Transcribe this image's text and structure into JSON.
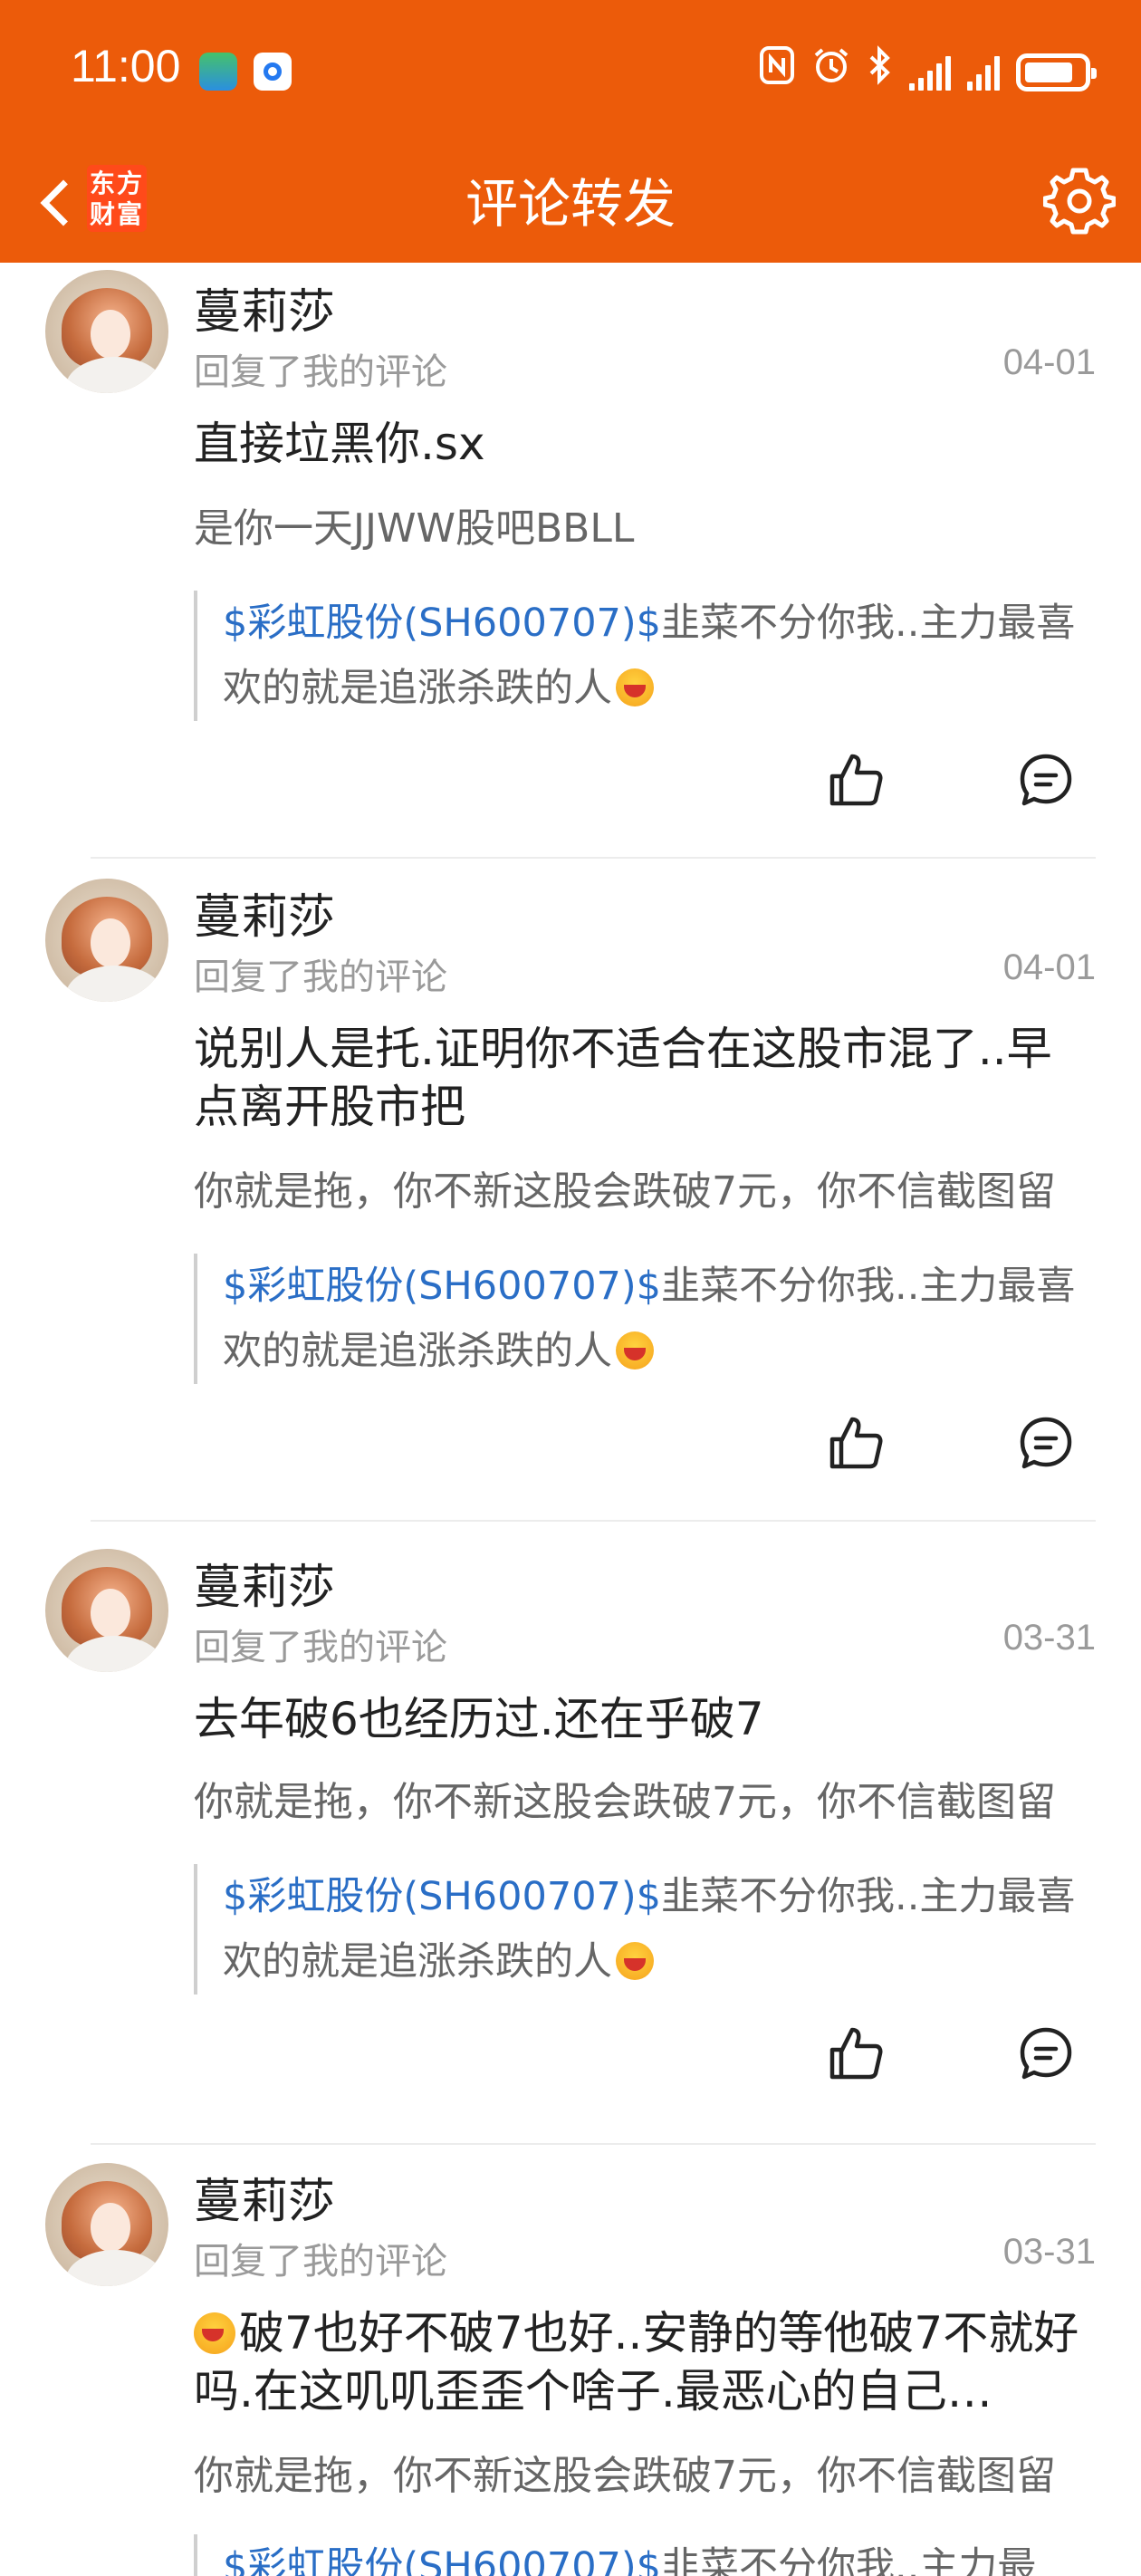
{
  "status_bar": {
    "time": "11:00",
    "icons": [
      "app-notification-icon",
      "app-notification-icon",
      "nfc-icon",
      "alarm-icon",
      "bluetooth-icon",
      "signal-icon",
      "signal-icon",
      "battery-icon"
    ]
  },
  "header": {
    "title": "评论转发",
    "logo_text": "东方财富",
    "back_icon": "chevron-left-icon",
    "settings_icon": "gear-icon"
  },
  "colors": {
    "brand_orange": "#ec5b0a",
    "link_blue": "#2a6ec6"
  },
  "comments": [
    {
      "username": "蔓莉莎",
      "action": "回复了我的评论",
      "date": "04-01",
      "content": "直接垃黑你.sx",
      "original": "是你一天JJWW股吧BBLL",
      "quote_stock": "$彩虹股份(SH600707)$",
      "quote_text": "韭菜不分你我..主力最喜欢的就是追涨杀跌的人"
    },
    {
      "username": "蔓莉莎",
      "action": "回复了我的评论",
      "date": "04-01",
      "content": "说别人是托.证明你不适合在这股市混了..早点离开股市把",
      "original": "你就是拖，你不新这股会跌破7元，你不信截图留",
      "quote_stock": "$彩虹股份(SH600707)$",
      "quote_text": "韭菜不分你我..主力最喜欢的就是追涨杀跌的人"
    },
    {
      "username": "蔓莉莎",
      "action": "回复了我的评论",
      "date": "03-31",
      "content": "去年破6也经历过.还在乎破7",
      "original": "你就是拖，你不新这股会跌破7元，你不信截图留",
      "quote_stock": "$彩虹股份(SH600707)$",
      "quote_text": "韭菜不分你我..主力最喜欢的就是追涨杀跌的人"
    },
    {
      "username": "蔓莉莎",
      "action": "回复了我的评论",
      "date": "03-31",
      "content": "破7也好不破7也好..安静的等他破7不就好吗.在这叽叽歪歪个啥子.最恶心的自己…",
      "original": "你就是拖，你不新这股会跌破7元，你不信截图留",
      "quote_stock": "$彩虹股份(SH600707)$",
      "quote_text": "韭菜不分你我..主力最"
    }
  ]
}
